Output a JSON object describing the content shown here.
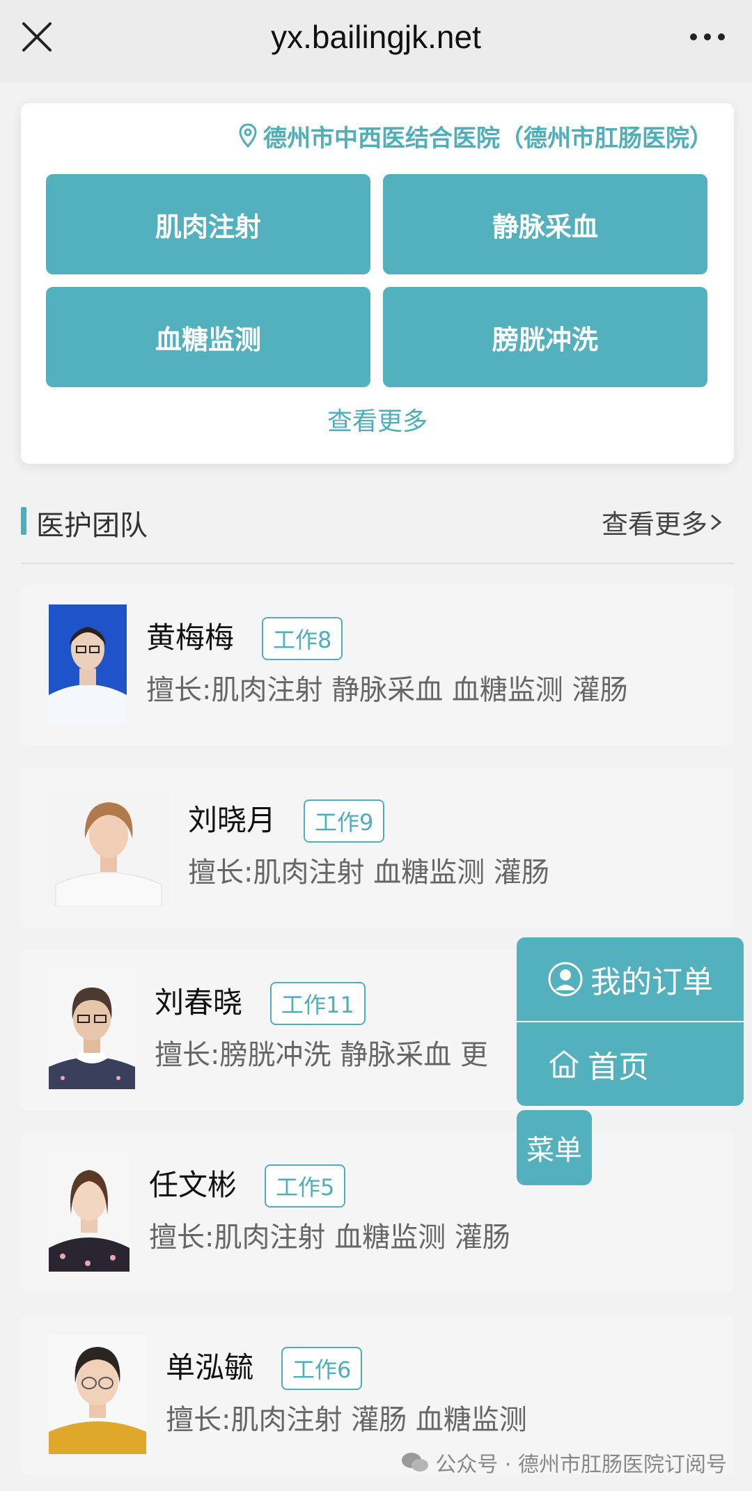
{
  "topbar": {
    "url": "yx.bailingjk.net"
  },
  "service": {
    "hospital": "德州市中西医结合医院（德州市肛肠医院）",
    "buttons": [
      "肌肉注射",
      "静脉采血",
      "血糖监测",
      "膀胱冲洗"
    ],
    "more": "查看更多"
  },
  "team": {
    "title": "医护团队",
    "more": "查看更多",
    "members": [
      {
        "name": "黄梅梅",
        "badge": "工作8",
        "skills": "擅长:肌肉注射 静脉采血 血糖监测 灌肠"
      },
      {
        "name": "刘晓月",
        "badge": "工作9",
        "skills": "擅长:肌肉注射 血糖监测 灌肠"
      },
      {
        "name": "刘春晓",
        "badge": "工作11",
        "skills": "擅长:膀胱冲洗 静脉采血 更"
      },
      {
        "name": "任文彬",
        "badge": "工作5",
        "skills": "擅长:肌肉注射 血糖监测 灌肠"
      },
      {
        "name": "单泓毓",
        "badge": "工作6",
        "skills": "擅长:肌肉注射 灌肠 血糖监测"
      }
    ]
  },
  "float_menu": {
    "orders": "我的订单",
    "home": "首页",
    "menu": "菜单"
  },
  "watermark": "公众号 · 德州市肛肠医院订阅号",
  "colors": {
    "accent": "#52b1bd",
    "accent_text": "#4eaeba"
  }
}
